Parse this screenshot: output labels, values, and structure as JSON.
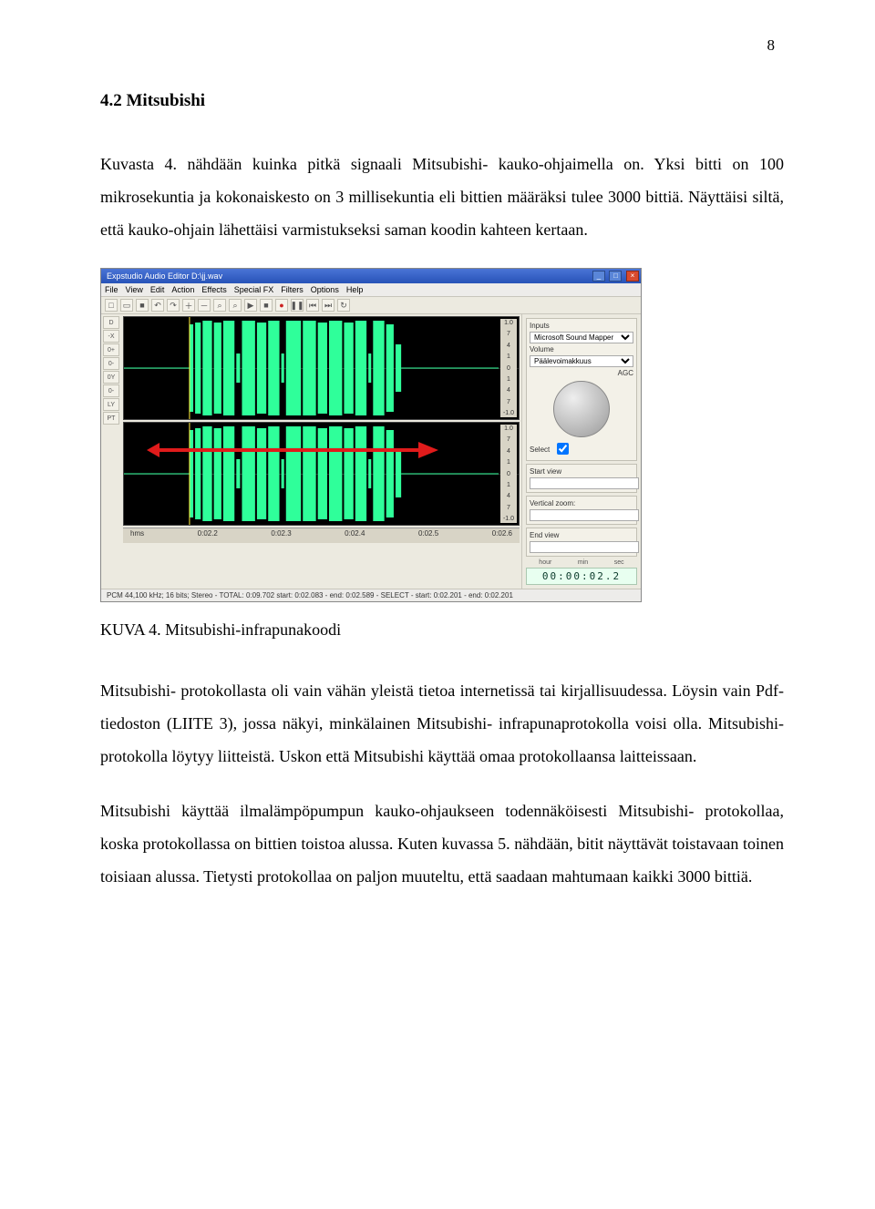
{
  "page": {
    "number": "8"
  },
  "section": {
    "heading": "4.2  Mitsubishi"
  },
  "para1": "Kuvasta 4. nähdään kuinka pitkä signaali Mitsubishi- kauko-ohjaimella on. Yksi bitti on 100 mikrosekuntia ja kokonaiskesto on 3 millisekuntia eli bittien määräksi tulee 3000 bittiä. Näyttäisi siltä, että kauko-ohjain lähettäisi varmistukseksi saman koodin kahteen kertaan.",
  "figure": {
    "caption": "KUVA 4. Mitsubishi-infrapunakoodi"
  },
  "para2": "Mitsubishi- protokollasta oli vain vähän yleistä tietoa internetissä tai kirjallisuudessa. Löysin vain Pdf-tiedoston (LIITE 3), jossa näkyi, minkälainen Mitsubishi- infrapunaprotokolla voisi olla. Mitsubishi- protokolla löytyy liitteistä. Uskon että Mitsubishi käyttää omaa protokollaansa laitteissaan.",
  "para3": "Mitsubishi käyttää ilmalämpöpumpun kauko-ohjaukseen todennäköisesti Mitsubishi- protokollaa, koska protokollassa on bittien toistoa alussa. Kuten kuvassa 5. nähdään, bitit näyttävät toistavaan toinen toisiaan alussa. Tietysti protokollaa on paljon muuteltu, että saadaan mahtumaan kaikki 3000 bittiä.",
  "screenshot": {
    "title": "Expstudio Audio Editor   D:\\jj.wav",
    "menu": [
      "File",
      "View",
      "Edit",
      "Action",
      "Effects",
      "Special FX",
      "Filters",
      "Options",
      "Help"
    ],
    "left_tools": [
      "D",
      "-X",
      "0+",
      "0-",
      "0Y",
      "0-",
      "LY",
      "PT"
    ],
    "ruler": [
      "hms",
      "0:02.2",
      "0:02.3",
      "0:02.4",
      "0:02.5",
      "0:02.6"
    ],
    "panel": {
      "input_label": "Inputs",
      "input_device": "Microsoft Sound Mapper",
      "volume": "Volume",
      "channel": "Päälevoimakkuus",
      "agc": "AGC",
      "select": "Select",
      "start_view": "Start view",
      "vertical_zoom": "Vertical zoom:",
      "end_view": "End view",
      "timecode": "00:00:02.2",
      "tc_labels": [
        "hour",
        "min",
        "sec"
      ]
    },
    "status": "PCM 44,100 kHz; 16 bits; Stereo - TOTAL: 0:09.702    start: 0:02.083 - end: 0:02.589 - SELECT - start: 0:02.201 - end: 0:02.201"
  }
}
